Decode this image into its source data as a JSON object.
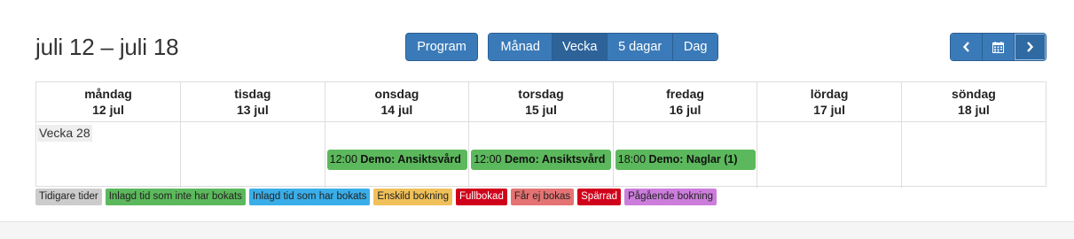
{
  "header": {
    "title": "juli 12 – juli 18",
    "program_label": "Program",
    "views": [
      {
        "label": "Månad",
        "active": false
      },
      {
        "label": "Vecka",
        "active": true
      },
      {
        "label": "5 dagar",
        "active": false
      },
      {
        "label": "Dag",
        "active": false
      }
    ],
    "nav_icons": [
      "chevron-left-icon",
      "calendar-icon",
      "chevron-right-icon"
    ]
  },
  "calendar": {
    "days": [
      {
        "name": "måndag",
        "date": "12 jul"
      },
      {
        "name": "tisdag",
        "date": "13 jul"
      },
      {
        "name": "onsdag",
        "date": "14 jul"
      },
      {
        "name": "torsdag",
        "date": "15 jul"
      },
      {
        "name": "fredag",
        "date": "16 jul"
      },
      {
        "name": "lördag",
        "date": "17 jul"
      },
      {
        "name": "söndag",
        "date": "18 jul"
      }
    ],
    "week_label": "Vecka 28",
    "events": [
      {
        "time": "12:00",
        "title": "Demo: Ansiktsvård"
      },
      {
        "time": "12:00",
        "title": "Demo: Ansiktsvård"
      },
      {
        "time": "18:00",
        "title": "Demo: Naglar (1)"
      }
    ]
  },
  "legend": [
    {
      "label": "Tidigare tider",
      "color": "#cccccc",
      "text": "dark"
    },
    {
      "label": "Inlagd tid som inte har bokats",
      "color": "#5cb85c",
      "text": "dark"
    },
    {
      "label": "Inlagd tid som har bokats",
      "color": "#3aaee8",
      "text": "dark"
    },
    {
      "label": "Enskild bokning",
      "color": "#f0c05a",
      "text": "dark"
    },
    {
      "label": "Fullbokad",
      "color": "#d0021b",
      "text": "light"
    },
    {
      "label": "Får ej bokas",
      "color": "#e57373",
      "text": "dark"
    },
    {
      "label": "Spärrad",
      "color": "#d0021b",
      "text": "light"
    },
    {
      "label": "Pågående bokning",
      "color": "#cc7ddc",
      "text": "dark"
    }
  ]
}
